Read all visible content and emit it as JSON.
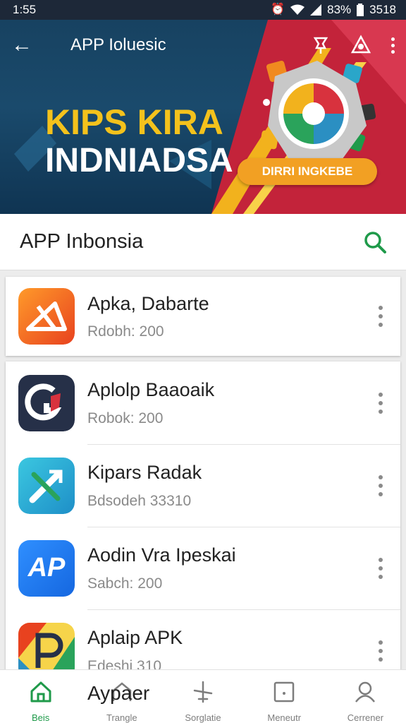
{
  "status_bar": {
    "time": "1:55",
    "battery_percent": "83%",
    "right_text": "3518",
    "icons": [
      "alarm-icon",
      "wifi-icon",
      "signal-icon",
      "battery-icon"
    ]
  },
  "hero": {
    "app_bar_title": "APP Ioluesic",
    "headline_line1": "KIPS KIRA",
    "headline_line2": "INDNIADSA",
    "badge_label": "DIRRI INGKEBE",
    "action_icons": [
      "pin-icon",
      "gamepad-icon",
      "more-vert-icon"
    ]
  },
  "search_row": {
    "label": "APP Inbonsia"
  },
  "featured_app": {
    "name": "Apka, Dabarte",
    "subtitle": "Rdobh: 200",
    "icon": "orange-shape-icon"
  },
  "app_list": [
    {
      "name": "Aplolp Baaoaik",
      "subtitle": "Robok: 200",
      "icon": "red-g-icon"
    },
    {
      "name": "Kipars Radak",
      "subtitle": "Bdsodeh 33310",
      "icon": "x-feather-icon"
    },
    {
      "name": "Aodin Vra Ipeskai",
      "subtitle": "Sabch: 200",
      "icon": "ap-icon",
      "icon_text": "AP"
    },
    {
      "name": "Aplaip APK",
      "subtitle": "Edeshi 310",
      "icon": "colorful-p-icon"
    }
  ],
  "bottom_nav": {
    "overlay_text": "Aypaer",
    "items": [
      {
        "label": "Beis",
        "icon": "home-icon",
        "active": true
      },
      {
        "label": "Trangle",
        "icon": "house-outline-icon",
        "active": false
      },
      {
        "label": "Sorglatie",
        "icon": "plane-icon",
        "active": false
      },
      {
        "label": "Meneutr",
        "icon": "calendar-icon",
        "active": false
      },
      {
        "label": "Cerrener",
        "icon": "person-icon",
        "active": false
      }
    ]
  },
  "colors": {
    "accent_green": "#1f9a4a",
    "hero_yellow": "#f4c21c",
    "badge_orange": "#f2a023",
    "hero_blue": "#174261",
    "hero_red": "#c3233a"
  }
}
